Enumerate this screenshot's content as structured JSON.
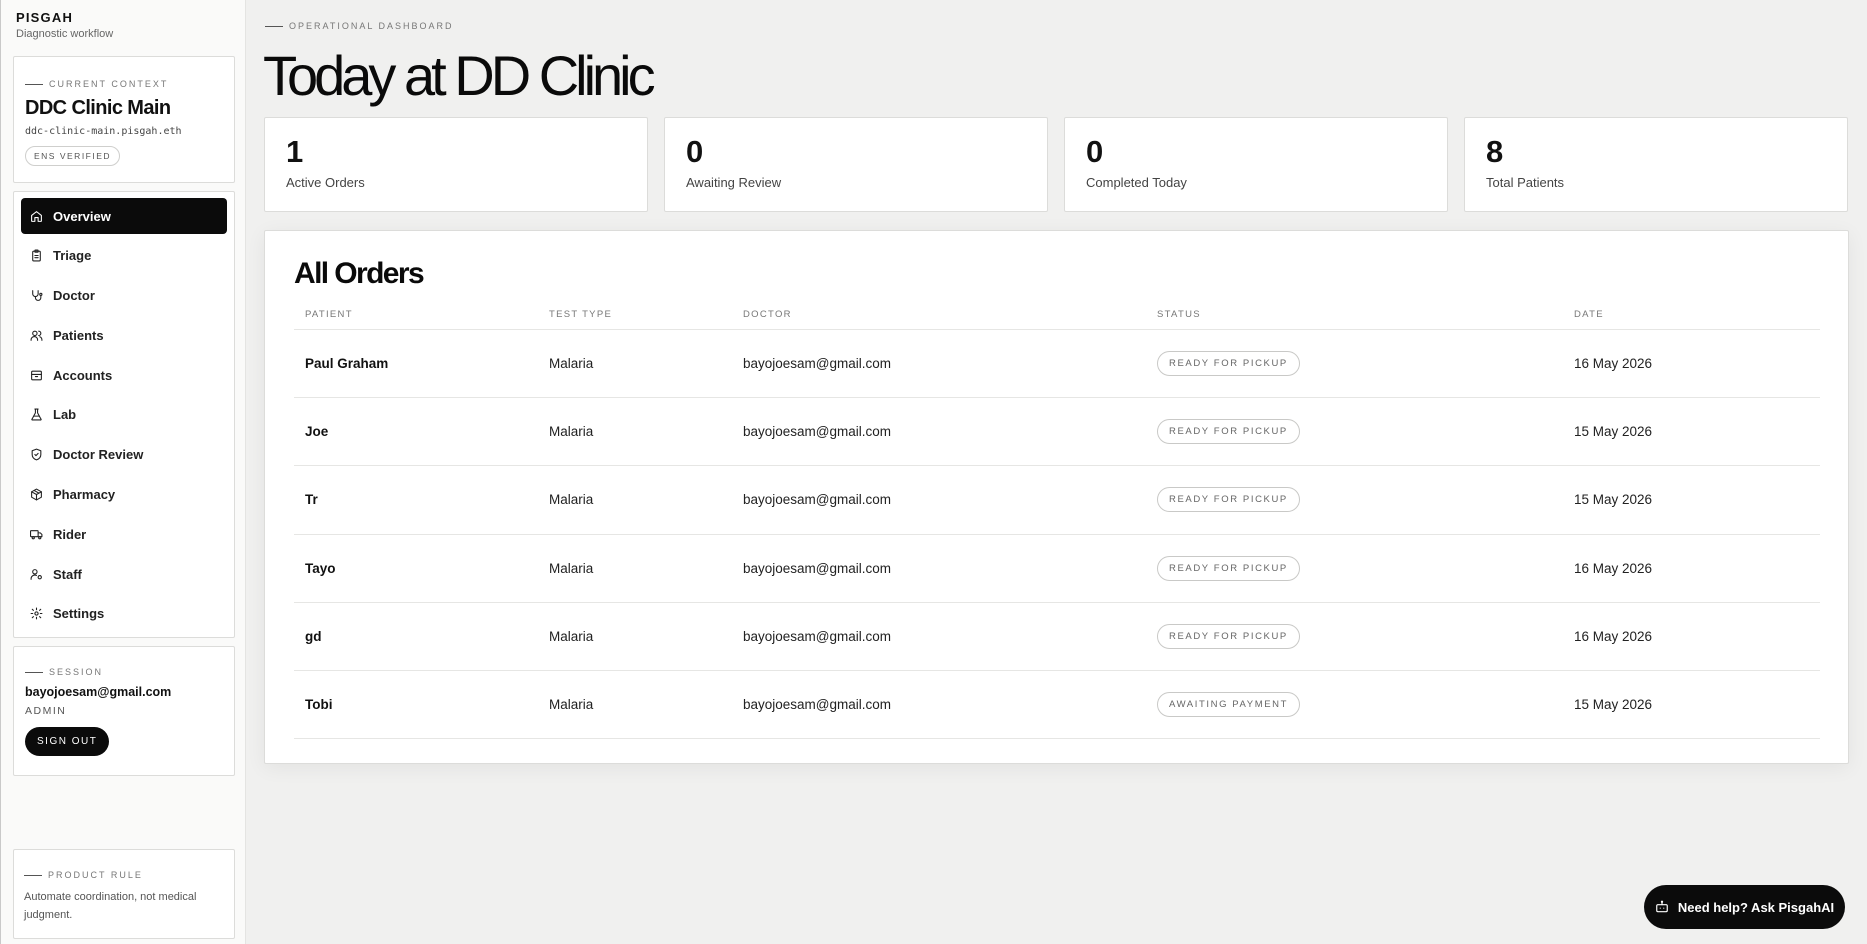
{
  "brand": {
    "name": "PISGAH",
    "subtitle": "Diagnostic workflow"
  },
  "context": {
    "kicker": "CURRENT CONTEXT",
    "title": "DDC Clinic Main",
    "domain": "ddc-clinic-main.pisgah.eth",
    "badge": "ENS VERIFIED"
  },
  "nav": {
    "items": [
      {
        "label": "Overview",
        "icon": "home-icon"
      },
      {
        "label": "Triage",
        "icon": "clipboard-icon"
      },
      {
        "label": "Doctor",
        "icon": "stethoscope-icon"
      },
      {
        "label": "Patients",
        "icon": "users-icon"
      },
      {
        "label": "Accounts",
        "icon": "archive-icon"
      },
      {
        "label": "Lab",
        "icon": "flask-icon"
      },
      {
        "label": "Doctor Review",
        "icon": "shield-check-icon"
      },
      {
        "label": "Pharmacy",
        "icon": "package-icon"
      },
      {
        "label": "Rider",
        "icon": "truck-icon"
      },
      {
        "label": "Staff",
        "icon": "user-cog-icon"
      },
      {
        "label": "Settings",
        "icon": "gear-icon"
      }
    ]
  },
  "session": {
    "kicker": "SESSION",
    "email": "bayojoesam@gmail.com",
    "role": "ADMIN",
    "signout_label": "SIGN OUT"
  },
  "product_rule": {
    "kicker": "PRODUCT RULE",
    "text": "Automate coordination, not medical judgment."
  },
  "main": {
    "kicker": "OPERATIONAL DASHBOARD",
    "title": "Today at DD Clinic"
  },
  "stats": [
    {
      "value": "1",
      "label": "Active Orders"
    },
    {
      "value": "0",
      "label": "Awaiting Review"
    },
    {
      "value": "0",
      "label": "Completed Today"
    },
    {
      "value": "8",
      "label": "Total Patients"
    }
  ],
  "orders": {
    "title": "All Orders",
    "columns": [
      "PATIENT",
      "TEST TYPE",
      "DOCTOR",
      "STATUS",
      "DATE"
    ],
    "rows": [
      {
        "patient": "Paul Graham",
        "test": "Malaria",
        "doctor": "bayojoesam@gmail.com",
        "status": "READY FOR PICKUP",
        "date": "16 May 2026"
      },
      {
        "patient": "Joe",
        "test": "Malaria",
        "doctor": "bayojoesam@gmail.com",
        "status": "READY FOR PICKUP",
        "date": "15 May 2026"
      },
      {
        "patient": "Tr",
        "test": "Malaria",
        "doctor": "bayojoesam@gmail.com",
        "status": "READY FOR PICKUP",
        "date": "15 May 2026"
      },
      {
        "patient": "Tayo",
        "test": "Malaria",
        "doctor": "bayojoesam@gmail.com",
        "status": "READY FOR PICKUP",
        "date": "16 May 2026"
      },
      {
        "patient": "gd",
        "test": "Malaria",
        "doctor": "bayojoesam@gmail.com",
        "status": "READY FOR PICKUP",
        "date": "16 May 2026"
      },
      {
        "patient": "Tobi",
        "test": "Malaria",
        "doctor": "bayojoesam@gmail.com",
        "status": "AWAITING PAYMENT",
        "date": "15 May 2026"
      }
    ]
  },
  "help": {
    "label": "Need help? Ask PisgahAI",
    "icon": "bot-icon"
  }
}
